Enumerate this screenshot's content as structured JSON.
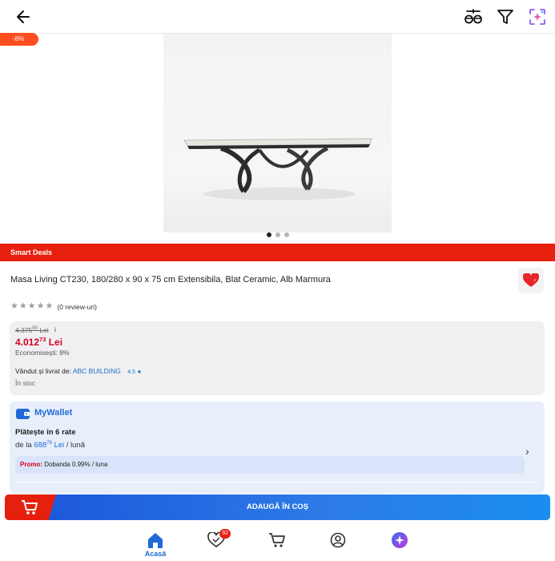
{
  "discount_badge": "-8%",
  "carousel": {
    "count": 3,
    "active_index": 0
  },
  "section_banner": "Smart Deals",
  "product": {
    "title": "Masa Living CT230, 180/280 x 90 x 75 cm Extensibila, Blat Ceramic, Alb Marmura",
    "rating_stars": 0,
    "reviews_text": "(0 review-uri)"
  },
  "price": {
    "old_main": "4.375",
    "old_sup": "90",
    "old_currency": "Lei",
    "info_icon": "i",
    "new_main": "4.012",
    "new_sup": "73",
    "new_currency": "Lei",
    "savings": "Economisești: 8%"
  },
  "seller": {
    "label": "Vândut și livrat de:",
    "name": "ABC BUILDING",
    "rating": "4.5",
    "stock": "În stoc"
  },
  "wallet": {
    "title": "MyWallet",
    "installments": "Plătește în 6 rate",
    "from": "de la",
    "amount_main": "688",
    "amount_sup": "78",
    "currency": "Lei",
    "period": "/ lună",
    "promo_label": "Promo:",
    "promo_text": "Dobanda 0.99% / luna"
  },
  "cta": {
    "add_to_cart": "ADAUGĂ ÎN COȘ"
  },
  "bottom_nav": {
    "home_label": "Acasă",
    "favorites_count": "92"
  },
  "colors": {
    "accent_blue": "#1e6ad6",
    "deal_red": "#e6200e",
    "price_red": "#d5001f"
  },
  "icons": [
    "arrow-left-icon",
    "compare-icon",
    "filter-icon",
    "ai-search-icon",
    "heart-icon",
    "star-icon",
    "wallet-icon",
    "chevron-right-icon",
    "cart-icon",
    "home-icon",
    "favorites-icon",
    "account-icon",
    "genius-ai-icon"
  ]
}
